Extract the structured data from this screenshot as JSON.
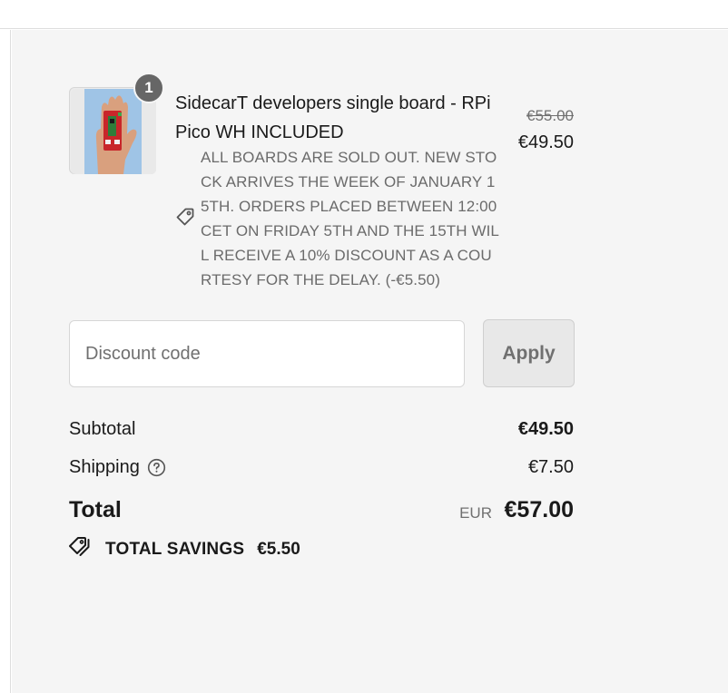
{
  "cart_item": {
    "quantity": "1",
    "title": "SidecarT developers single board - RPi Pico WH INCLUDED",
    "discount_message": "ALL BOARDS ARE SOLD OUT. NEW STOCK ARRIVES THE WEEK OF JANUARY 15TH. ORDERS PLACED BETWEEN 12:00 CET ON FRIDAY 5TH AND THE 15TH WILL RECEIVE A 10% DISCOUNT AS A COURTESY FOR THE DELAY. (-€5.50)",
    "original_price": "€55.00",
    "current_price": "€49.50",
    "image_icon": "product-photo-hand-holding-board"
  },
  "discount_code": {
    "placeholder": "Discount code",
    "value": "",
    "apply_label": "Apply"
  },
  "summary": {
    "subtotal_label": "Subtotal",
    "subtotal_value": "€49.50",
    "shipping_label": "Shipping",
    "shipping_help_icon": "question-circle-icon",
    "shipping_value": "€7.50",
    "total_label": "Total",
    "total_currency": "EUR",
    "total_value": "€57.00",
    "savings_icon": "tags-icon",
    "savings_label": "TOTAL SAVINGS",
    "savings_value": "€5.50"
  },
  "colors": {
    "panel_background": "#f5f5f5",
    "badge": "#666666",
    "muted_text": "#707070"
  }
}
